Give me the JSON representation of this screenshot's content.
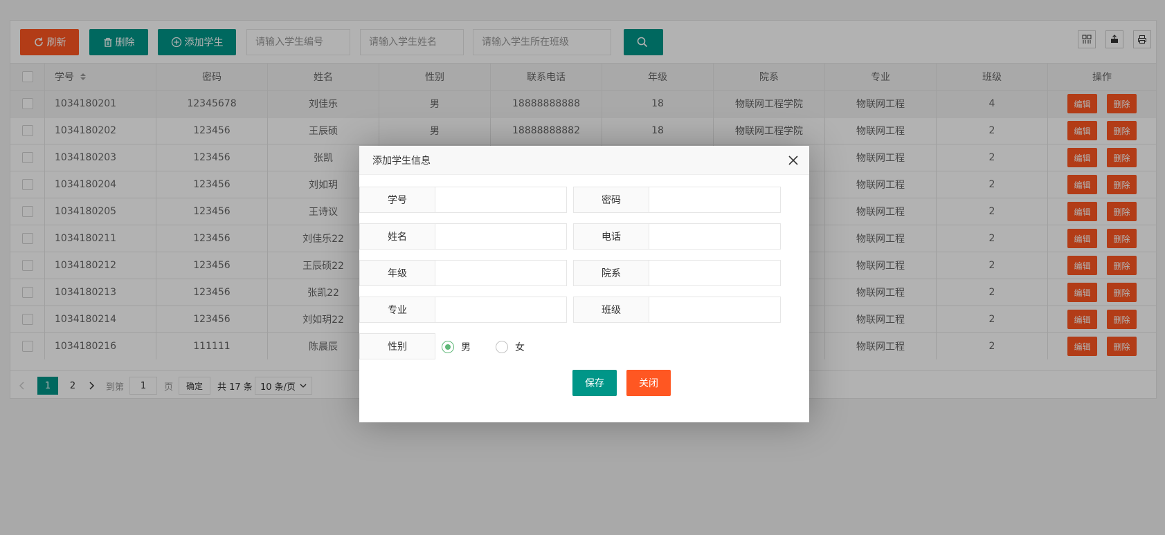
{
  "toolbar": {
    "refresh": "刷新",
    "delete": "删除",
    "add_student": "添加学生",
    "search_id_placeholder": "请输入学生编号",
    "search_name_placeholder": "请输入学生姓名",
    "search_class_placeholder": "请输入学生所在班级"
  },
  "table": {
    "headers": [
      "学号",
      "密码",
      "姓名",
      "性别",
      "联系电话",
      "年级",
      "院系",
      "专业",
      "班级",
      "操作"
    ],
    "edit_label": "编辑",
    "delete_label": "删除",
    "rows": [
      {
        "id": "1034180201",
        "pwd": "12345678",
        "name": "刘佳乐",
        "sex": "男",
        "phone": "18888888888",
        "grade": "18",
        "dept": "物联网工程学院",
        "major": "物联网工程",
        "cls": "4"
      },
      {
        "id": "1034180202",
        "pwd": "123456",
        "name": "王辰硕",
        "sex": "男",
        "phone": "18888888882",
        "grade": "18",
        "dept": "物联网工程学院",
        "major": "物联网工程",
        "cls": "2"
      },
      {
        "id": "1034180203",
        "pwd": "123456",
        "name": "张凯",
        "sex": "",
        "phone": "",
        "grade": "",
        "dept": "",
        "major": "物联网工程",
        "cls": "2"
      },
      {
        "id": "1034180204",
        "pwd": "123456",
        "name": "刘如玥",
        "sex": "",
        "phone": "",
        "grade": "",
        "dept": "",
        "major": "物联网工程",
        "cls": "2"
      },
      {
        "id": "1034180205",
        "pwd": "123456",
        "name": "王诗议",
        "sex": "",
        "phone": "",
        "grade": "",
        "dept": "",
        "major": "物联网工程",
        "cls": "2"
      },
      {
        "id": "1034180211",
        "pwd": "123456",
        "name": "刘佳乐22",
        "sex": "",
        "phone": "",
        "grade": "",
        "dept": "",
        "major": "物联网工程",
        "cls": "2"
      },
      {
        "id": "1034180212",
        "pwd": "123456",
        "name": "王辰硕22",
        "sex": "",
        "phone": "",
        "grade": "",
        "dept": "",
        "major": "物联网工程",
        "cls": "2"
      },
      {
        "id": "1034180213",
        "pwd": "123456",
        "name": "张凯22",
        "sex": "",
        "phone": "",
        "grade": "",
        "dept": "",
        "major": "物联网工程",
        "cls": "2"
      },
      {
        "id": "1034180214",
        "pwd": "123456",
        "name": "刘如玥22",
        "sex": "",
        "phone": "",
        "grade": "",
        "dept": "",
        "major": "物联网工程",
        "cls": "2"
      },
      {
        "id": "1034180216",
        "pwd": "111111",
        "name": "陈晨辰",
        "sex": "",
        "phone": "",
        "grade": "",
        "dept": "",
        "major": "物联网工程",
        "cls": "2"
      }
    ]
  },
  "pager": {
    "page1": "1",
    "page2": "2",
    "goto": "到第",
    "goto_value": "1",
    "page_unit": "页",
    "confirm": "确定",
    "total": "共 17 条",
    "page_size": "10 条/页"
  },
  "dialog": {
    "title": "添加学生信息",
    "labels": {
      "id": "学号",
      "pwd": "密码",
      "name": "姓名",
      "phone": "电话",
      "grade": "年级",
      "dept": "院系",
      "major": "专业",
      "cls": "班级",
      "sex": "性别"
    },
    "sex_male": "男",
    "sex_female": "女",
    "save": "保存",
    "close": "关闭"
  },
  "colors": {
    "teal": "#009688",
    "orange": "#FF5722",
    "radio_green": "#5FB878"
  }
}
